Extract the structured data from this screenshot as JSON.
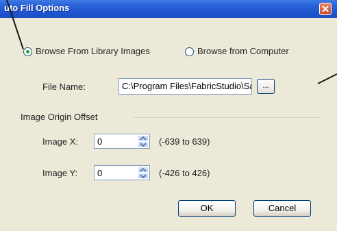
{
  "window": {
    "title": "uto Fill Options"
  },
  "source": {
    "option_library": "Browse From Library Images",
    "option_computer": "Browse from Computer",
    "selected": "library"
  },
  "file": {
    "label": "File Name:",
    "value": "C:\\Program Files\\FabricStudio\\Sa",
    "browse_label": "..."
  },
  "offset": {
    "group_label": "Image Origin Offset",
    "x_label": "Image X:",
    "x_value": "0",
    "x_range": "(-639 to 639)",
    "y_label": "Image Y:",
    "y_value": "0",
    "y_range": "(-426 to 426)"
  },
  "buttons": {
    "ok": "OK",
    "cancel": "Cancel"
  },
  "colors": {
    "titlebar": "#2a62d8",
    "dialog_bg": "#ece9d8",
    "close": "#c8482a",
    "radio_dot": "#21a121"
  }
}
